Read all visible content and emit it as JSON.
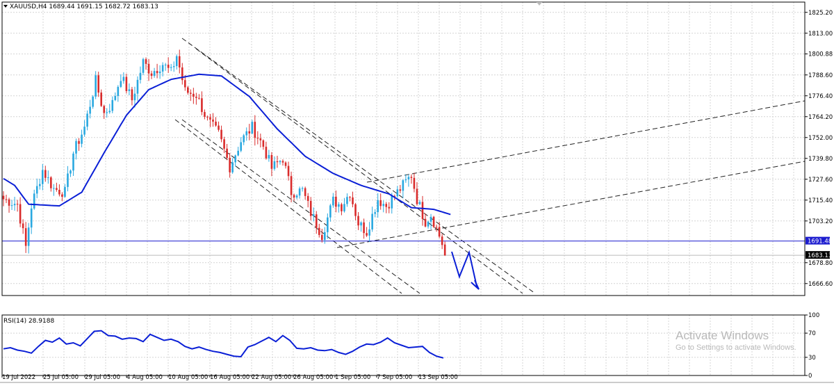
{
  "header": {
    "symbol_line": "XAUUSD,H4  1689.44 1691.15 1682.72 1683.13",
    "rsi_line": "RSI(14) 28.9188"
  },
  "price_badges": {
    "hline": "1691.48",
    "last": "1683.13"
  },
  "watermark": {
    "title": "Activate Windows",
    "subtitle": "Go to Settings to activate Windows."
  },
  "colors": {
    "bull": "#29a8e0",
    "bear": "#d92b2b",
    "ma": "#0a1fd6",
    "rsi": "#0a1fd6",
    "hline": "#1c1ccf",
    "grid": "#d4d4d4"
  },
  "chart_data": [
    {
      "type": "candlestick",
      "symbol": "XAUUSD",
      "timeframe": "H4",
      "ohlc_current": {
        "open": 1689.44,
        "high": 1691.15,
        "low": 1682.72,
        "close": 1683.13
      },
      "ylim": [
        1659.6,
        1831.2
      ],
      "price_ticks": [
        "1825.20",
        "1813.00",
        "1800.88",
        "1788.60",
        "1776.40",
        "1764.20",
        "1752.00",
        "1739.80",
        "1727.60",
        "1715.40",
        "1703.20",
        "1678.80",
        "1666.60"
      ],
      "x_ticks": [
        "19 Jul 2022",
        "25 Jul 05:00",
        "29 Jul 05:00",
        "4 Aug 05:00",
        "10 Aug 05:00",
        "16 Aug 05:00",
        "22 Aug 05:00",
        "26 Aug 05:00",
        "1 Sep 05:00",
        "7 Sep 05:00",
        "13 Sep 05:00"
      ],
      "price_path": [
        {
          "bar": 0,
          "close": 1716
        },
        {
          "bar": 5,
          "close": 1713
        },
        {
          "bar": 8,
          "close": 1688
        },
        {
          "bar": 10,
          "close": 1712
        },
        {
          "bar": 14,
          "close": 1733
        },
        {
          "bar": 18,
          "close": 1722
        },
        {
          "bar": 22,
          "close": 1720
        },
        {
          "bar": 25,
          "close": 1743
        },
        {
          "bar": 29,
          "close": 1758
        },
        {
          "bar": 33,
          "close": 1785
        },
        {
          "bar": 36,
          "close": 1766
        },
        {
          "bar": 39,
          "close": 1772
        },
        {
          "bar": 42,
          "close": 1788
        },
        {
          "bar": 46,
          "close": 1774
        },
        {
          "bar": 50,
          "close": 1796
        },
        {
          "bar": 53,
          "close": 1790
        },
        {
          "bar": 57,
          "close": 1795
        },
        {
          "bar": 60,
          "close": 1790
        },
        {
          "bar": 62,
          "close": 1800
        },
        {
          "bar": 65,
          "close": 1779
        },
        {
          "bar": 69,
          "close": 1777
        },
        {
          "bar": 73,
          "close": 1762
        },
        {
          "bar": 77,
          "close": 1754
        },
        {
          "bar": 81,
          "close": 1735
        },
        {
          "bar": 85,
          "close": 1750
        },
        {
          "bar": 89,
          "close": 1758
        },
        {
          "bar": 93,
          "close": 1747
        },
        {
          "bar": 96,
          "close": 1734
        },
        {
          "bar": 100,
          "close": 1740
        },
        {
          "bar": 103,
          "close": 1720
        },
        {
          "bar": 107,
          "close": 1721
        },
        {
          "bar": 110,
          "close": 1708
        },
        {
          "bar": 114,
          "close": 1695
        },
        {
          "bar": 118,
          "close": 1715
        },
        {
          "bar": 121,
          "close": 1712
        },
        {
          "bar": 124,
          "close": 1720
        },
        {
          "bar": 127,
          "close": 1702
        },
        {
          "bar": 130,
          "close": 1697
        },
        {
          "bar": 134,
          "close": 1716
        },
        {
          "bar": 137,
          "close": 1712
        },
        {
          "bar": 140,
          "close": 1718
        },
        {
          "bar": 143,
          "close": 1724
        },
        {
          "bar": 146,
          "close": 1730
        },
        {
          "bar": 148,
          "close": 1716
        },
        {
          "bar": 151,
          "close": 1703
        },
        {
          "bar": 153,
          "close": 1707
        },
        {
          "bar": 155,
          "close": 1699
        },
        {
          "bar": 157,
          "close": 1690
        },
        {
          "bar": 158,
          "close": 1683
        }
      ],
      "moving_average": [
        {
          "bar": 0,
          "value": 1728
        },
        {
          "bar": 4,
          "value": 1724
        },
        {
          "bar": 9,
          "value": 1713
        },
        {
          "bar": 20,
          "value": 1712
        },
        {
          "bar": 28,
          "value": 1720
        },
        {
          "bar": 36,
          "value": 1743
        },
        {
          "bar": 44,
          "value": 1765
        },
        {
          "bar": 52,
          "value": 1780
        },
        {
          "bar": 60,
          "value": 1786
        },
        {
          "bar": 70,
          "value": 1789
        },
        {
          "bar": 78,
          "value": 1788
        },
        {
          "bar": 88,
          "value": 1776
        },
        {
          "bar": 98,
          "value": 1757
        },
        {
          "bar": 108,
          "value": 1741
        },
        {
          "bar": 118,
          "value": 1731
        },
        {
          "bar": 128,
          "value": 1724
        },
        {
          "bar": 138,
          "value": 1719
        },
        {
          "bar": 146,
          "value": 1711
        },
        {
          "bar": 154,
          "value": 1710
        },
        {
          "bar": 160,
          "value": 1707
        }
      ],
      "horizontal_line": 1691.48
    },
    {
      "type": "line",
      "name": "RSI(14)",
      "last_value": 28.9188,
      "ylim": [
        0,
        100
      ],
      "y_ticks": [
        "100",
        "70",
        "30",
        "0"
      ],
      "values": [
        44,
        46,
        42,
        40,
        37,
        48,
        58,
        55,
        62,
        52,
        54,
        49,
        61,
        73,
        74,
        66,
        65,
        60,
        62,
        61,
        56,
        68,
        63,
        58,
        60,
        56,
        48,
        44,
        47,
        43,
        40,
        38,
        35,
        32,
        31,
        47,
        51,
        57,
        63,
        56,
        66,
        58,
        45,
        44,
        46,
        42,
        41,
        43,
        38,
        35,
        40,
        47,
        52,
        51,
        55,
        62,
        54,
        50,
        46,
        47,
        48,
        38,
        32,
        29
      ]
    }
  ]
}
